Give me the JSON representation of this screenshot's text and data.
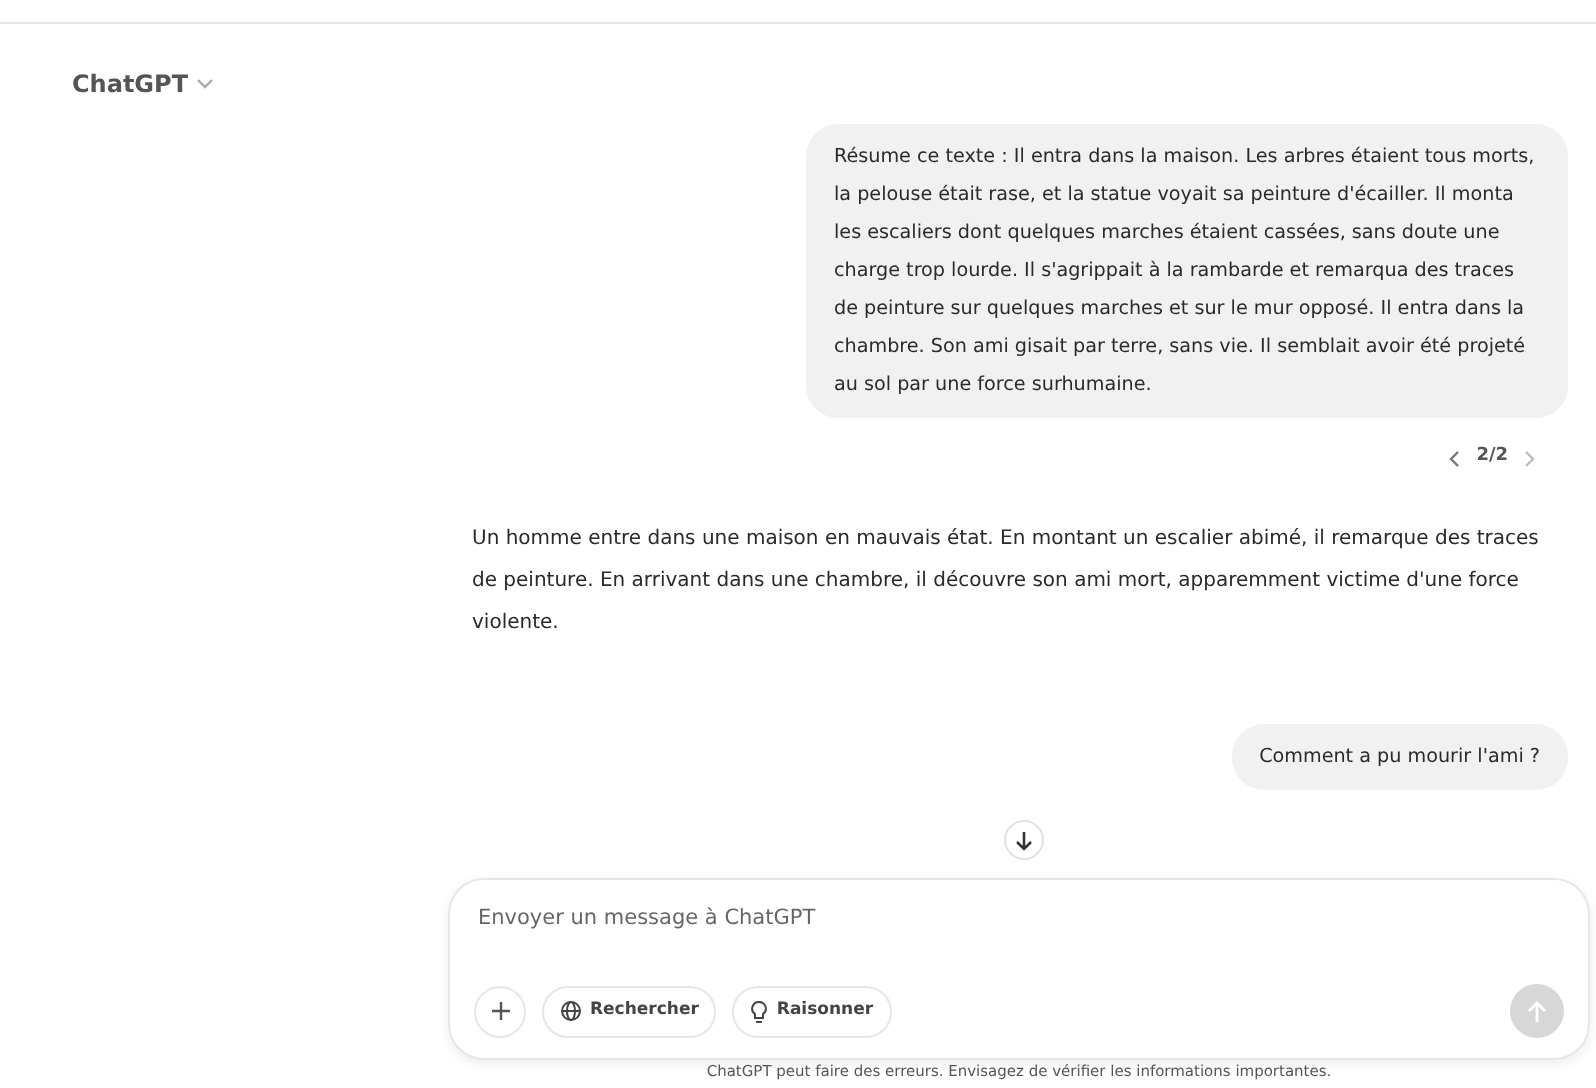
{
  "header": {
    "model": "ChatGPT"
  },
  "messages": [
    {
      "kind": "user",
      "text": "Résume ce texte : Il entra dans la maison. Les arbres étaient tous morts, la pelouse était rase, et la statue voyait sa peinture d'écailler. Il monta les escaliers dont quelques marches étaient cassées, sans doute une charge trop lourde. Il s'agrippait à la rambarde et remarqua des traces de peinture sur quelques marches et sur le mur opposé. Il entra dans la chambre. Son ami gisait par terre, sans vie. Il semblait avoir été projeté au sol par une force surhumaine.",
      "pager": "2/2"
    },
    {
      "kind": "assistant",
      "text": "Un homme entre dans une maison en mauvais état. En montant un escalier abimé, il remarque des traces de peinture. En arrivant dans une chambre, il découvre son ami mort, apparemment victime d'une force violente."
    },
    {
      "kind": "user",
      "text": "Comment a pu mourir l'ami ?"
    }
  ],
  "composer": {
    "placeholder": "Envoyer un message à ChatGPT",
    "tools": [
      {
        "kind": "plus"
      },
      {
        "kind": "globe",
        "label": "Rechercher"
      },
      {
        "kind": "bulb",
        "label": "Raisonner"
      }
    ],
    "send_disabled": true
  },
  "disclaimer": "ChatGPT peut faire des erreurs. Envisagez de vérifier les informations importantes."
}
